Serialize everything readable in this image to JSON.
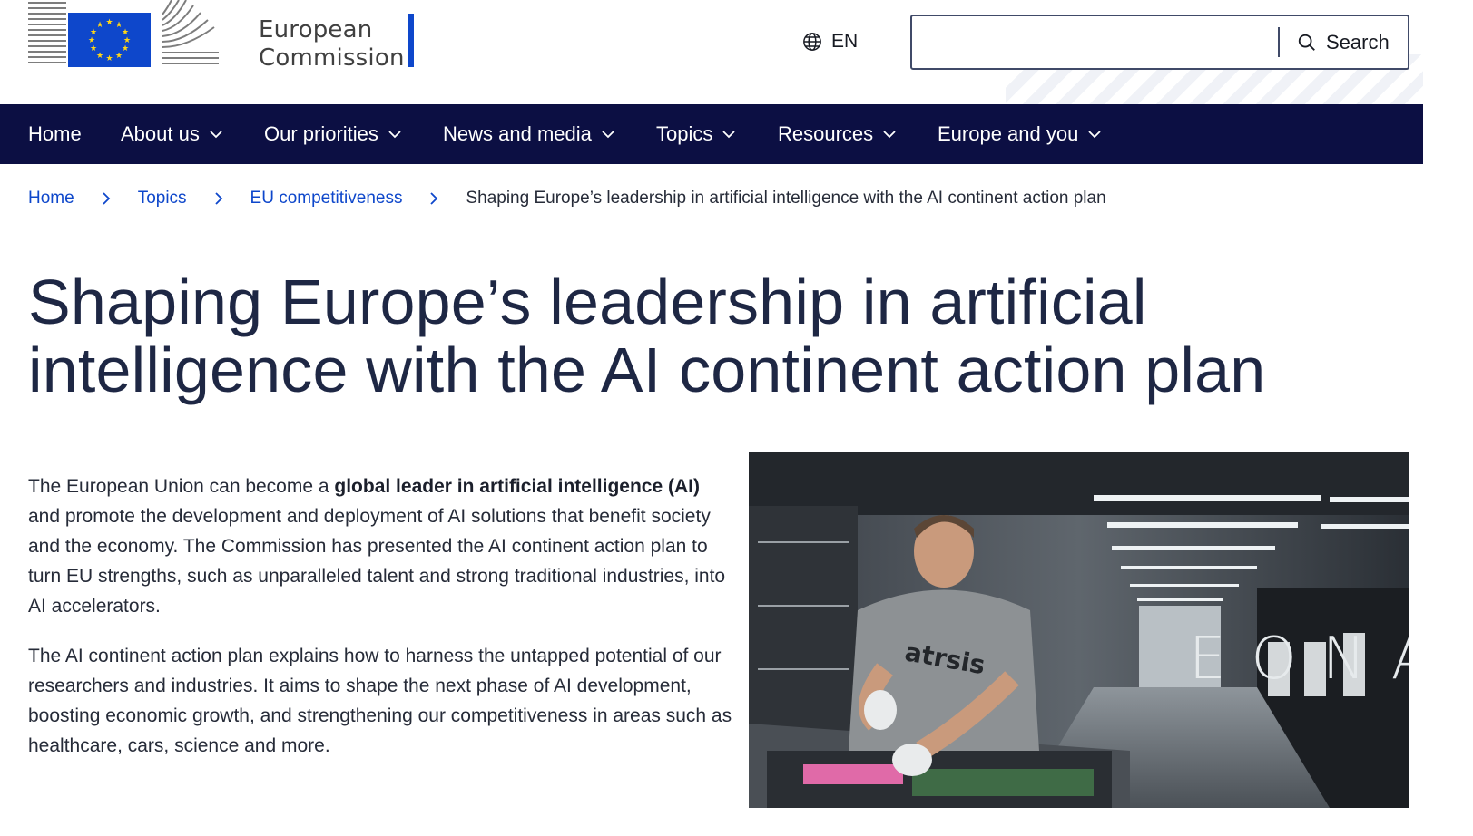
{
  "header": {
    "logo_line1": "European",
    "logo_line2": "Commission",
    "language": "EN",
    "search": {
      "placeholder": "",
      "value": "",
      "button_label": "Search"
    }
  },
  "nav": {
    "items": [
      {
        "label": "Home",
        "has_dropdown": false
      },
      {
        "label": "About us",
        "has_dropdown": true
      },
      {
        "label": "Our priorities",
        "has_dropdown": true
      },
      {
        "label": "News and media",
        "has_dropdown": true
      },
      {
        "label": "Topics",
        "has_dropdown": true
      },
      {
        "label": "Resources",
        "has_dropdown": true
      },
      {
        "label": "Europe and you",
        "has_dropdown": true
      }
    ]
  },
  "breadcrumb": {
    "items": [
      "Home",
      "Topics",
      "EU competitiveness"
    ],
    "current": "Shaping Europe’s leadership in artificial intelligence with the AI continent action plan"
  },
  "page": {
    "title": "Shaping Europe’s leadership in artificial intelligence with the AI continent action plan",
    "paragraph1_pre": "The European Union can become a ",
    "paragraph1_bold": "global leader in artificial intelligence (AI)",
    "paragraph1_post": " and promote the development and deployment of AI solutions that benefit society and the economy. The Commission has presented the AI continent action plan to turn EU strengths, such as unparalleled talent and strong traditional industries, into AI accelerators.",
    "paragraph2": "The AI continent action plan explains how to harness the untapped potential of our researchers and industries. It aims to shape the next phase of AI development, boosting economic growth, and strengthening our competitiveness in areas such as healthcare, cars, science and more.",
    "hero_image": {
      "shirt_text": "atrsis",
      "wall_letters": "EONA"
    }
  },
  "colors": {
    "nav_bg": "#0c0f43",
    "link": "#0e47cb",
    "title": "#1e2744",
    "eu_blue": "#0e47cb",
    "eu_star": "#ffd617"
  }
}
